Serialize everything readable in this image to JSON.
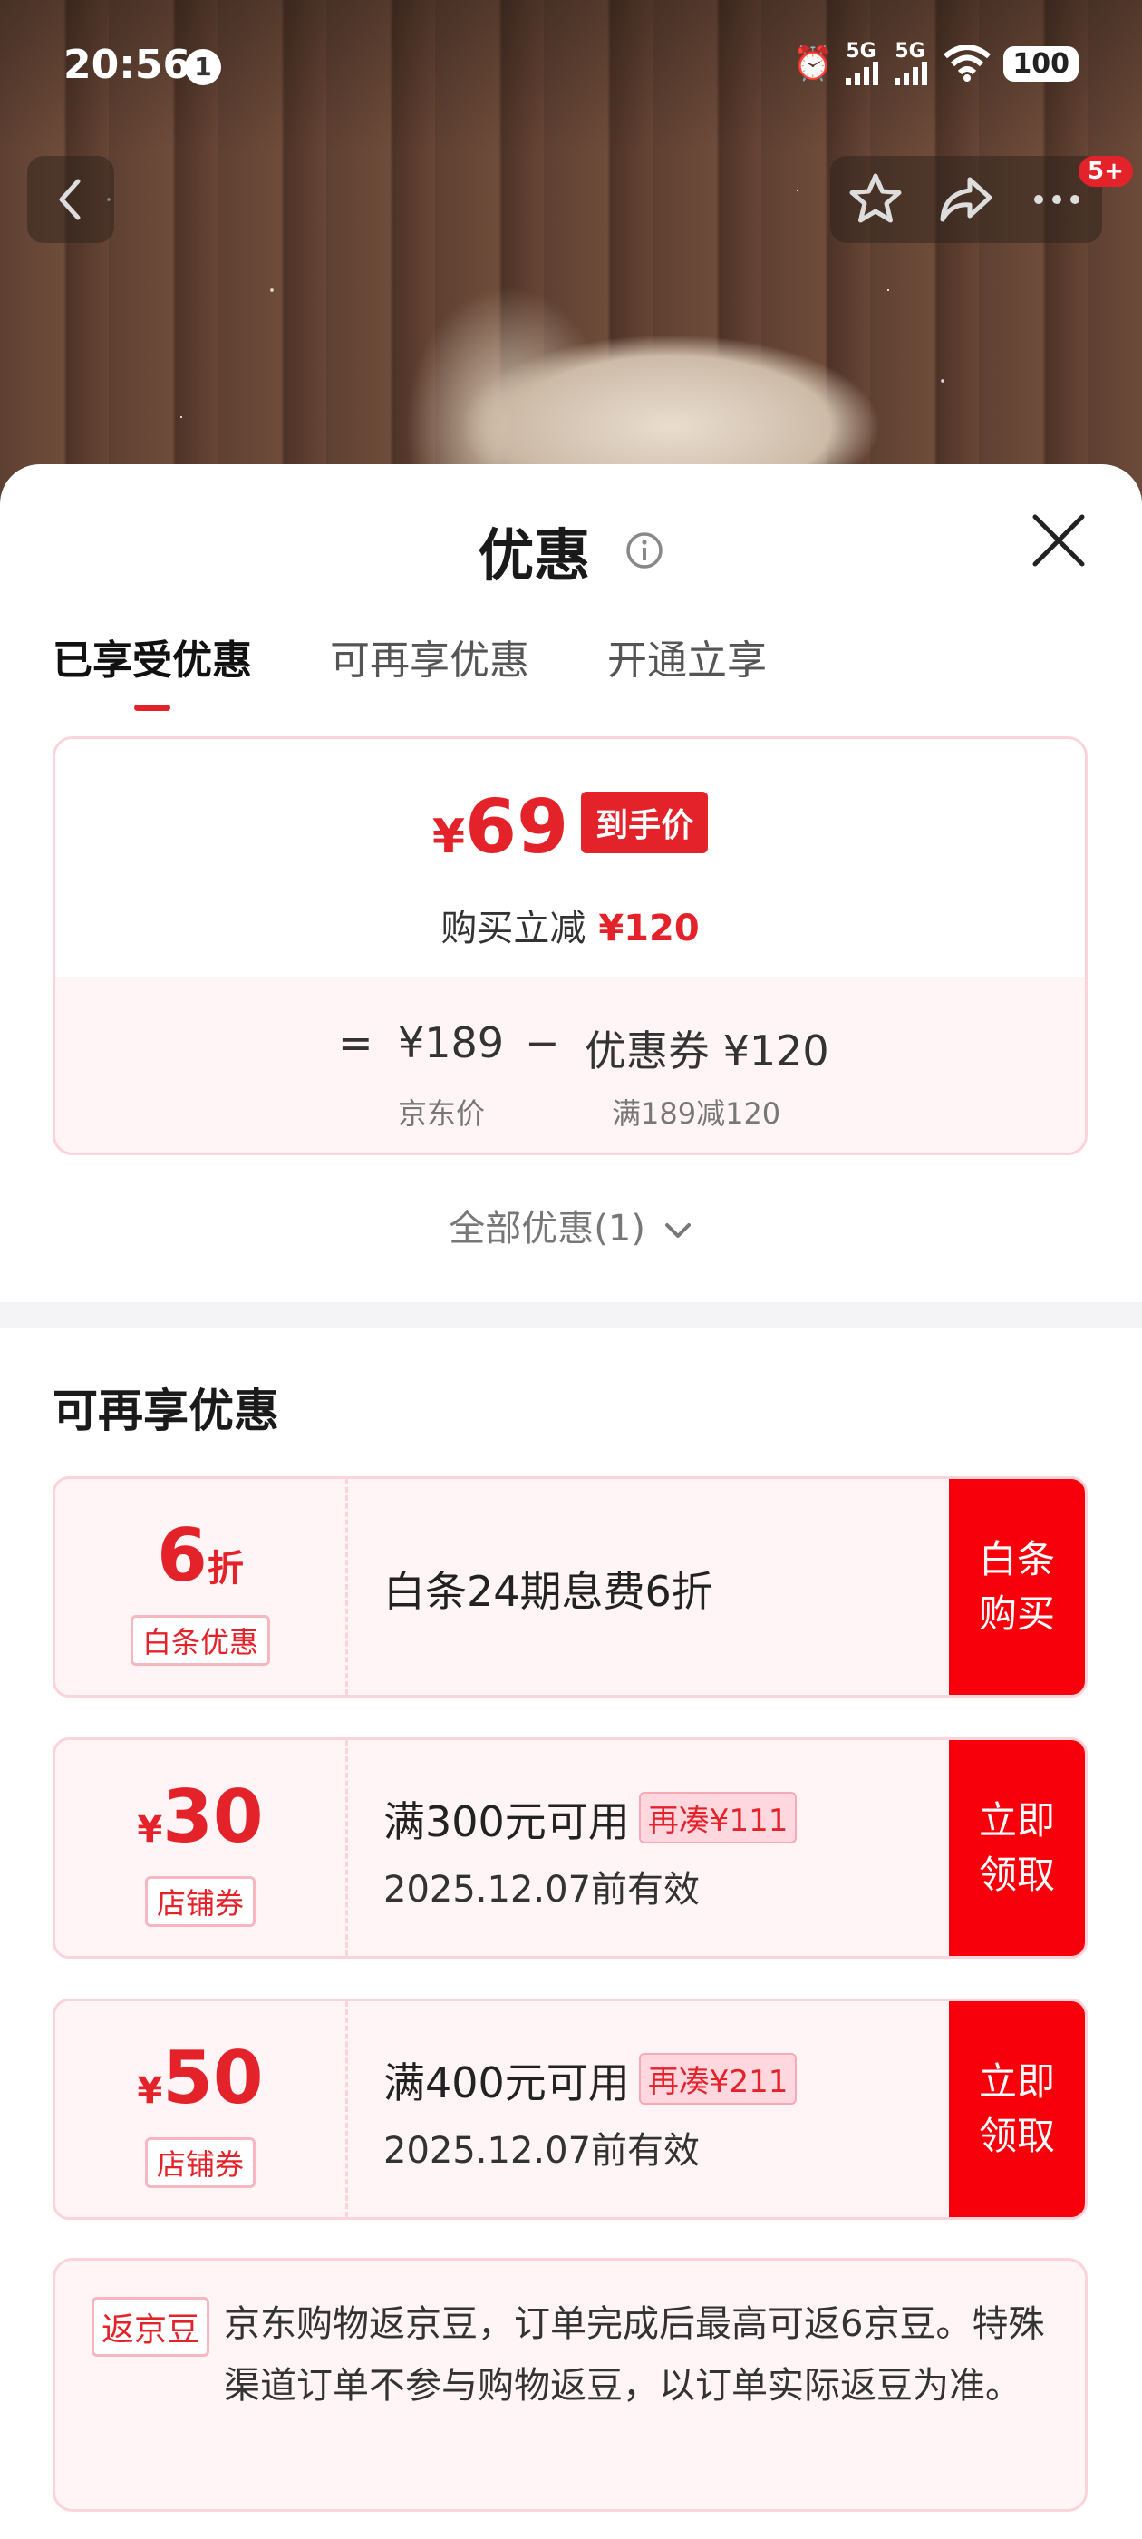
{
  "status_bar": {
    "time": "20:56",
    "notification_count": "1",
    "network_1": "5G",
    "network_2": "5G",
    "battery": "100"
  },
  "top_nav": {
    "badge": "5+"
  },
  "sheet": {
    "title": "优惠",
    "tabs": [
      "已享受优惠",
      "可再享优惠",
      "开通立享"
    ],
    "active_tab": 0,
    "price_card": {
      "currency": "¥",
      "final_price": "69",
      "final_tag": "到手价",
      "reduce_label": "购买立减",
      "reduce_value": "¥120",
      "equals": "=",
      "original_price": "¥189",
      "minus": "−",
      "coupon_text": "优惠券 ¥120",
      "original_label": "京东价",
      "coupon_label": "满189减120"
    },
    "all_offers": "全部优惠(1)",
    "more_section_title": "可再享优惠",
    "coupons": [
      {
        "value": "6",
        "unit": "折",
        "type": "白条优惠",
        "condition": "白条24期息费6折",
        "extra": "",
        "date": "",
        "action": "白条购买"
      },
      {
        "currency": "¥",
        "value": "30",
        "type": "店铺券",
        "condition": "满300元可用",
        "extra": "再凑¥111",
        "date": "2025.12.07前有效",
        "action": "立即领取"
      },
      {
        "currency": "¥",
        "value": "50",
        "type": "店铺券",
        "condition": "满400元可用",
        "extra": "再凑¥211",
        "date": "2025.12.07前有效",
        "action": "立即领取"
      }
    ],
    "beans": {
      "tag": "返京豆",
      "text": "京东购物返京豆，订单完成后最高可返6京豆。特殊渠道订单不参与购物返豆，以订单实际返豆为准。"
    }
  },
  "colors": {
    "accent": "#e4222a",
    "action_red": "#f8000b",
    "card_bg": "#fff5f6",
    "card_border": "#fbd3da"
  }
}
